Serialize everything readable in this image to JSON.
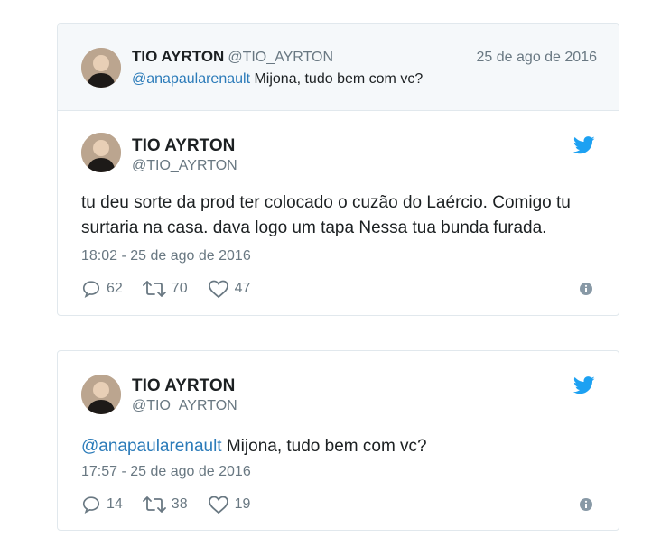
{
  "tweet1": {
    "parent": {
      "name": "TIO AYRTON",
      "handle": "@TIO_AYRTON",
      "date": "25 de ago de 2016",
      "mention": "@anapaularenault",
      "text": " Mijona, tudo bem com vc?"
    },
    "name": "TIO AYRTON",
    "handle": "@TIO_AYRTON",
    "text": "tu deu sorte da prod ter colocado o cuzão do Laércio. Comigo tu surtaria na casa. dava logo um tapa Nessa tua bunda furada.",
    "timestamp": "18:02 - 25 de ago de 2016",
    "replies": "62",
    "retweets": "70",
    "likes": "47"
  },
  "tweet2": {
    "name": "TIO AYRTON",
    "handle": "@TIO_AYRTON",
    "mention": "@anapaularenault",
    "text": " Mijona, tudo bem com vc?",
    "timestamp": "17:57 - 25 de ago de 2016",
    "replies": "14",
    "retweets": "38",
    "likes": "19"
  },
  "colors": {
    "link": "#2b7bb9",
    "twitter_blue": "#1da1f2",
    "muted": "#697882",
    "border": "#e1e8ed",
    "parent_bg": "#f5f8fa"
  },
  "icons": [
    "twitter-bird-icon",
    "reply-icon",
    "retweet-icon",
    "heart-icon",
    "info-icon"
  ]
}
